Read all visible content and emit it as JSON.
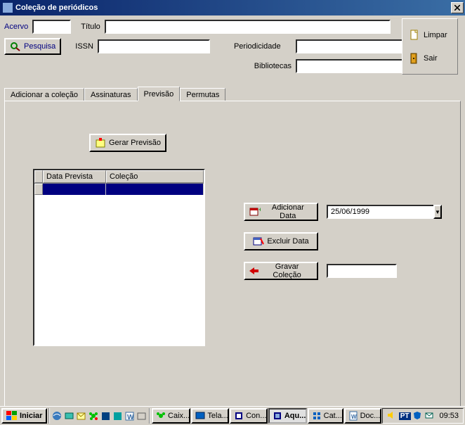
{
  "window": {
    "title": "Coleção de periódicos"
  },
  "form": {
    "acervo_label": "Acervo",
    "titulo_label": "Título",
    "pesquisa_button": "Pesquisa",
    "issn_label": "ISSN",
    "periodicidade_label": "Periodicidade",
    "bibliotecas_label": "Bibliotecas",
    "acervo_value": "",
    "titulo_value": "",
    "issn_value": "",
    "periodicidade_value": "",
    "bibliotecas_value": ""
  },
  "side": {
    "limpar": "Limpar",
    "sair": "Sair"
  },
  "tabs": {
    "adicionar": "Adicionar a coleção",
    "assinaturas": "Assinaturas",
    "previsao": "Previsão",
    "permutas": "Permutas"
  },
  "panel": {
    "gerar_previsao": "Gerar Previsão",
    "grid": {
      "col1": "Data Prevista",
      "col2": "Coleção"
    },
    "adicionar_data": "Adicionar Data",
    "date_value": "25/06/1999",
    "excluir_data": "Excluir Data",
    "gravar_colecao": "Gravar Coleção",
    "colecao_value": ""
  },
  "taskbar": {
    "start": "Iniciar",
    "tasks": [
      {
        "label": "Caix..."
      },
      {
        "label": "Tela..."
      },
      {
        "label": "Con..."
      },
      {
        "label": "Aqu..."
      },
      {
        "label": "Cat..."
      },
      {
        "label": "Doc..."
      }
    ],
    "lang": "PT",
    "clock": "09:53"
  }
}
